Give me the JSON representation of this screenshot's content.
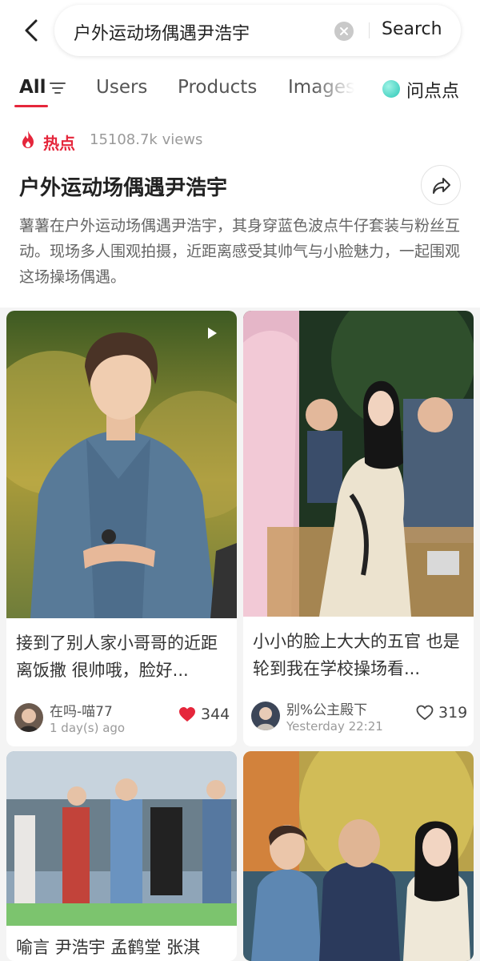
{
  "search": {
    "query": "户外运动场偶遇尹浩宇",
    "button_label": "Search"
  },
  "tabs": {
    "all": "All",
    "users": "Users",
    "products": "Products",
    "images": "Images",
    "ask": "问点点"
  },
  "hot_topic": {
    "badge": "热点",
    "views": "15108.7k views",
    "title": "户外运动场偶遇尹浩宇",
    "description": "薯薯在户外运动场偶遇尹浩宇，其身穿蓝色波点牛仔套装与粉丝互动。现场多人围观拍摄，近距离感受其帅气与小脸魅力，一起围观这场操场偶遇。"
  },
  "cards": [
    {
      "title": "接到了别人家小哥哥的近距离饭撒 很帅哦，脸好...",
      "author": "在吗-喵77",
      "time": "1 day(s) ago",
      "likes": "344",
      "liked": true,
      "is_video": true
    },
    {
      "title": "小小的脸上大大的五官 也是轮到我在学校操场看...",
      "author": "别%公主殿下",
      "time": "Yesterday 22:21",
      "likes": "319",
      "liked": false,
      "is_video": false
    },
    {
      "title": "喻言 尹浩宇 孟鹤堂 张淇"
    },
    {
      "title": ""
    }
  ],
  "colors": {
    "accent": "#e5263b",
    "background": "#f4f4f4",
    "ask_icon": "#2bc7b6"
  },
  "icons": {
    "back": "chevron-left-icon",
    "clear": "clear-icon",
    "filter": "filter-icon",
    "hot": "flame-icon",
    "share": "share-icon",
    "like": "heart-icon",
    "video": "play-icon"
  }
}
